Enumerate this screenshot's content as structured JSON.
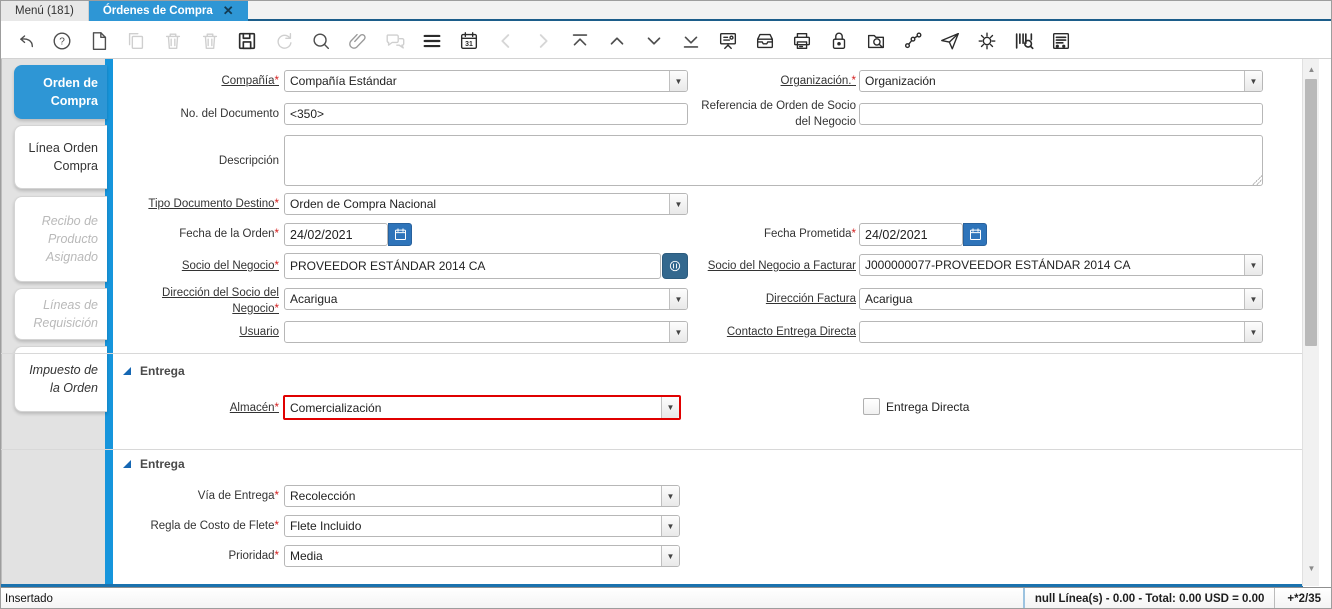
{
  "window_tabs": {
    "menu_tab": "Menú (181)",
    "active_tab": "Órdenes de Compra",
    "close_glyph": "✕"
  },
  "toolbar_icons": [
    {
      "name": "undo",
      "state": "enabled"
    },
    {
      "name": "help",
      "state": "enabled"
    },
    {
      "name": "new-record",
      "state": "enabled"
    },
    {
      "name": "copy-record",
      "state": "disabled"
    },
    {
      "name": "delete-record",
      "state": "disabled"
    },
    {
      "name": "delete-selection",
      "state": "disabled"
    },
    {
      "name": "save",
      "state": "enabled"
    },
    {
      "name": "refresh",
      "state": "disabled"
    },
    {
      "name": "find",
      "state": "enabled"
    },
    {
      "name": "attachment",
      "state": "enabled"
    },
    {
      "name": "chat",
      "state": "disabled"
    },
    {
      "name": "toggle-grid",
      "state": "enabled"
    },
    {
      "name": "calendar",
      "state": "enabled"
    },
    {
      "name": "parent-record",
      "state": "disabled"
    },
    {
      "name": "detail-record",
      "state": "disabled"
    },
    {
      "name": "first-record",
      "state": "enabled"
    },
    {
      "name": "previous-record",
      "state": "enabled"
    },
    {
      "name": "next-record",
      "state": "enabled"
    },
    {
      "name": "last-record",
      "state": "enabled"
    },
    {
      "name": "report",
      "state": "enabled"
    },
    {
      "name": "archive",
      "state": "enabled"
    },
    {
      "name": "print",
      "state": "enabled"
    },
    {
      "name": "private-lock",
      "state": "enabled"
    },
    {
      "name": "zoom-across",
      "state": "enabled"
    },
    {
      "name": "workflow",
      "state": "enabled"
    },
    {
      "name": "export",
      "state": "enabled"
    },
    {
      "name": "process",
      "state": "enabled"
    },
    {
      "name": "product-info",
      "state": "enabled"
    },
    {
      "name": "quick-form",
      "state": "enabled"
    }
  ],
  "sidebar_tabs": [
    {
      "label": "Orden de Compra",
      "state": "active"
    },
    {
      "label": "Línea Orden Compra",
      "state": "normal"
    },
    {
      "label": "Recibo de Producto Asignado",
      "state": "disabled"
    },
    {
      "label": "Líneas de Requisición",
      "state": "disabled"
    },
    {
      "label": "Impuesto de la Orden",
      "state": "normal-italic"
    }
  ],
  "fields": {
    "compania": {
      "label": "Compañía",
      "required": "*",
      "value": "Compañía Estándar"
    },
    "organizacion": {
      "label": "Organización.",
      "required": "*",
      "value": "Organización"
    },
    "no_documento": {
      "label": "No. del Documento",
      "value": "<350>"
    },
    "referencia": {
      "label": "Referencia de Orden de Socio del Negocio",
      "value": ""
    },
    "descripcion": {
      "label": "Descripción",
      "value": ""
    },
    "tipo_documento": {
      "label": "Tipo Documento Destino",
      "required": "*",
      "value": "Orden de Compra Nacional"
    },
    "fecha_orden": {
      "label": "Fecha de la Orden",
      "required": "*",
      "value": "24/02/2021"
    },
    "fecha_prometida": {
      "label": "Fecha Prometida",
      "required": "*",
      "value": "24/02/2021"
    },
    "socio_negocio": {
      "label": "Socio del Negocio",
      "required": "*",
      "value": "PROVEEDOR ESTÁNDAR 2014 CA"
    },
    "socio_facturar": {
      "label": "Socio del Negocio a Facturar",
      "value": "J000000077-PROVEEDOR ESTÁNDAR 2014 CA"
    },
    "direccion_socio": {
      "label": "Dirección del Socio del Negocio",
      "required": "*",
      "value": "Acarigua"
    },
    "direccion_factura": {
      "label": "Dirección Factura",
      "value": "Acarigua"
    },
    "usuario": {
      "label": "Usuario",
      "value": ""
    },
    "contacto_entrega": {
      "label": "Contacto Entrega Directa",
      "value": ""
    },
    "almacen": {
      "label": "Almacén",
      "required": "*",
      "value": "Comercialización",
      "highlighted": true
    },
    "entrega_directa": {
      "label": "Entrega Directa",
      "checked": false
    },
    "via_entrega": {
      "label": "Vía de Entrega",
      "required": "*",
      "value": "Recolección"
    },
    "regla_flete": {
      "label": "Regla de Costo de Flete",
      "required": "*",
      "value": "Flete Incluido"
    },
    "prioridad": {
      "label": "Prioridad",
      "required": "*",
      "value": "Media"
    }
  },
  "sections": {
    "entrega_1": "Entrega",
    "entrega_2": "Entrega"
  },
  "statusbar": {
    "state": "Insertado",
    "summary": "null Línea(s) - 0.00 - Total: 0.00 USD = 0.00",
    "record_indicator": "+*2/35"
  },
  "colors": {
    "accent_blue": "#2e96d5",
    "stripe_blue": "#1695dc",
    "highlight_red": "#e00000",
    "required_red": "#d42020"
  }
}
